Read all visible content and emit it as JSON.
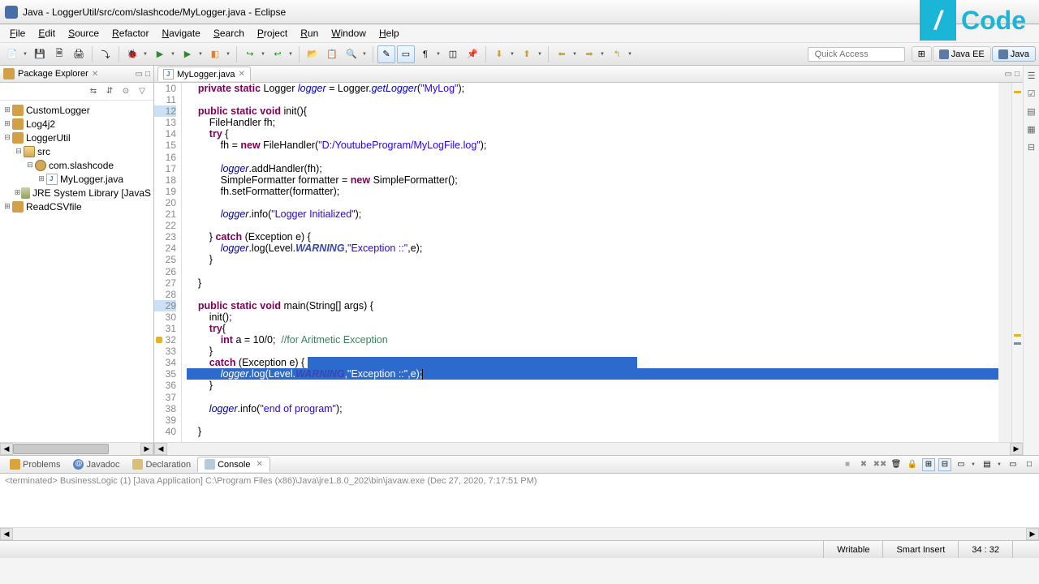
{
  "window": {
    "title": "Java - LoggerUtil/src/com/slashcode/MyLogger.java - Eclipse"
  },
  "brand": {
    "slash": "/",
    "code": "Code"
  },
  "menu": [
    "File",
    "Edit",
    "Source",
    "Refactor",
    "Navigate",
    "Search",
    "Project",
    "Run",
    "Window",
    "Help"
  ],
  "quick_access": "Quick Access",
  "perspectives": [
    {
      "label": "Java EE",
      "active": false
    },
    {
      "label": "Java",
      "active": true
    }
  ],
  "package_explorer": {
    "title": "Package Explorer",
    "tree": [
      {
        "label": "CustomLogger",
        "type": "prj",
        "level": 0,
        "open": false
      },
      {
        "label": "Log4j2",
        "type": "prj",
        "level": 0,
        "open": false
      },
      {
        "label": "LoggerUtil",
        "type": "prj",
        "level": 0,
        "open": true
      },
      {
        "label": "src",
        "type": "fld",
        "level": 1,
        "open": true
      },
      {
        "label": "com.slashcode",
        "type": "pkg",
        "level": 2,
        "open": true
      },
      {
        "label": "MyLogger.java",
        "type": "java",
        "level": 3,
        "open": false
      },
      {
        "label": "JRE System Library [JavaS",
        "type": "lib",
        "level": 1,
        "open": false
      },
      {
        "label": "ReadCSVfile",
        "type": "prj",
        "level": 0,
        "open": false
      }
    ]
  },
  "editor": {
    "tab": "MyLogger.java",
    "first_line_no": 10,
    "lines": [
      {
        "n": 10,
        "html": "    <span class='kw'>private static</span> Logger <span class='it'>logger</span> = Logger.<span class='it'>getLogger</span>(<span class='str'>\"MyLog\"</span>);"
      },
      {
        "n": 11,
        "html": ""
      },
      {
        "n": 12,
        "html": "    <span class='kw'>public static void</span> init(){",
        "mmark": true
      },
      {
        "n": 13,
        "html": "        FileHandler fh;"
      },
      {
        "n": 14,
        "html": "        <span class='kw'>try</span> {"
      },
      {
        "n": 15,
        "html": "            fh = <span class='kw'>new</span> FileHandler(<span class='str'>\"D:/YoutubeProgram/MyLogFile.log\"</span>);"
      },
      {
        "n": 16,
        "html": ""
      },
      {
        "n": 17,
        "html": "            <span class='it'>logger</span>.addHandler(fh);"
      },
      {
        "n": 18,
        "html": "            SimpleFormatter formatter = <span class='kw'>new</span> SimpleFormatter();"
      },
      {
        "n": 19,
        "html": "            fh.setFormatter(formatter);"
      },
      {
        "n": 20,
        "html": ""
      },
      {
        "n": 21,
        "html": "            <span class='it'>logger</span>.info(<span class='str'>\"Logger Initialized\"</span>);"
      },
      {
        "n": 22,
        "html": ""
      },
      {
        "n": 23,
        "html": "        } <span class='kw'>catch</span> (Exception e) {"
      },
      {
        "n": 24,
        "html": "            <span class='it'>logger</span>.log(Level.<span class='static-it'>WARNING</span>,<span class='str'>\"Exception ::\"</span>,e);"
      },
      {
        "n": 25,
        "html": "        }"
      },
      {
        "n": 26,
        "html": ""
      },
      {
        "n": 27,
        "html": "    }"
      },
      {
        "n": 28,
        "html": ""
      },
      {
        "n": 29,
        "html": "    <span class='kw'>public static void</span> main(String[] args) {",
        "mmark": true
      },
      {
        "n": 30,
        "html": "        init();"
      },
      {
        "n": 31,
        "html": "        <span class='kw'>try</span>{"
      },
      {
        "n": 32,
        "html": "            <span class='kw'>int</span> a = 10/0;  <span class='cmt'>//for Aritmetic Exception</span>",
        "warn": true
      },
      {
        "n": 33,
        "html": "        }"
      },
      {
        "n": 34,
        "html": "        <span class='kw'>catch</span> (Exception e) {",
        "sel_part": "                                                                                                                     "
      },
      {
        "n": 35,
        "html": "            <span class='it'>logger</span>.log(Level.<span class='static-it'>WARNING</span>,<span class='str'>\"Exception ::\"</span>,e);",
        "sel_full": true
      },
      {
        "n": 36,
        "html": "        }"
      },
      {
        "n": 37,
        "html": ""
      },
      {
        "n": 38,
        "html": "        <span class='it'>logger</span>.info(<span class='str'>\"end of program\"</span>);"
      },
      {
        "n": 39,
        "html": ""
      },
      {
        "n": 40,
        "html": "    }"
      }
    ]
  },
  "bottom_tabs": [
    "Problems",
    "Javadoc",
    "Declaration",
    "Console"
  ],
  "console": {
    "status": "<terminated> BusinessLogic (1) [Java Application] C:\\Program Files (x86)\\Java\\jre1.8.0_202\\bin\\javaw.exe (Dec 27, 2020, 7:17:51 PM)"
  },
  "status": {
    "writable": "Writable",
    "insert": "Smart Insert",
    "pos": "34 : 32"
  }
}
